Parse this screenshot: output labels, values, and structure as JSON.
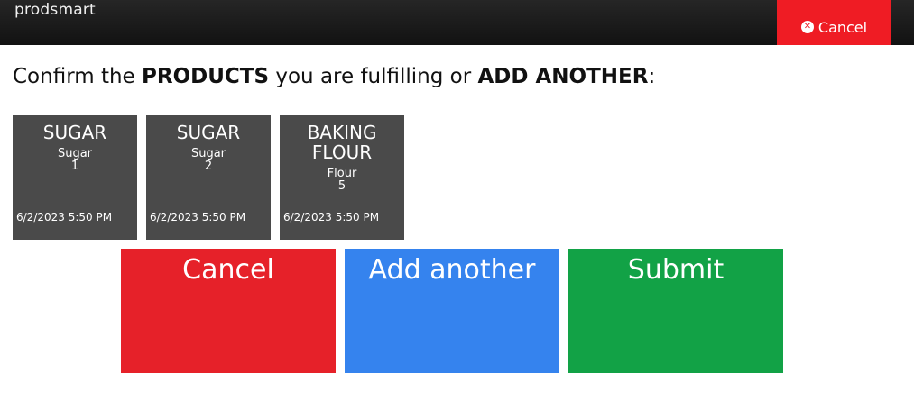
{
  "header": {
    "brand": "prodsmart",
    "cancel_label": "Cancel",
    "cancel_icon": "times-circle-icon"
  },
  "prompt": {
    "part1": "Confirm the ",
    "bold1": "PRODUCTS",
    "part2": " you are fulfilling or ",
    "bold2": "ADD ANOTHER",
    "part3": ":"
  },
  "products": [
    {
      "name": "SUGAR",
      "category": "Sugar",
      "quantity": "1",
      "date": "6/2/2023 5:50 PM"
    },
    {
      "name": "SUGAR",
      "category": "Sugar",
      "quantity": "2",
      "date": "6/2/2023 5:50 PM"
    },
    {
      "name": "BAKING FLOUR",
      "category": "Flour",
      "quantity": "5",
      "date": "6/2/2023 5:50 PM"
    }
  ],
  "actions": {
    "cancel_label": "Cancel",
    "add_another_label": "Add another",
    "submit_label": "Submit"
  },
  "colors": {
    "cancel": "#e62129",
    "add_another": "#3583ee",
    "submit": "#12a246",
    "tile": "#4a4a4a",
    "header_cancel": "#ef1c24"
  }
}
